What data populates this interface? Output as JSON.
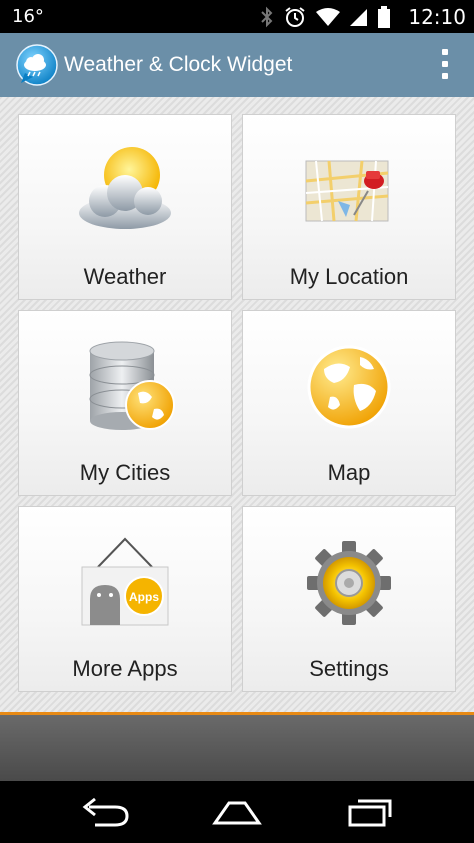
{
  "status_bar": {
    "temperature": "16°",
    "time": "12:10"
  },
  "action_bar": {
    "title": "Weather & Clock Widget"
  },
  "tiles": [
    {
      "label": "Weather",
      "icon": "weather-cloud-sun-icon"
    },
    {
      "label": "My Location",
      "icon": "map-pin-icon"
    },
    {
      "label": "My Cities",
      "icon": "database-globe-icon"
    },
    {
      "label": "Map",
      "icon": "globe-icon"
    },
    {
      "label": "More Apps",
      "icon": "apps-sign-icon"
    },
    {
      "label": "Settings",
      "icon": "gear-icon"
    }
  ],
  "colors": {
    "action_bar": "#6b8fa8",
    "accent": "#e88a15",
    "globe": "#f5b400"
  }
}
